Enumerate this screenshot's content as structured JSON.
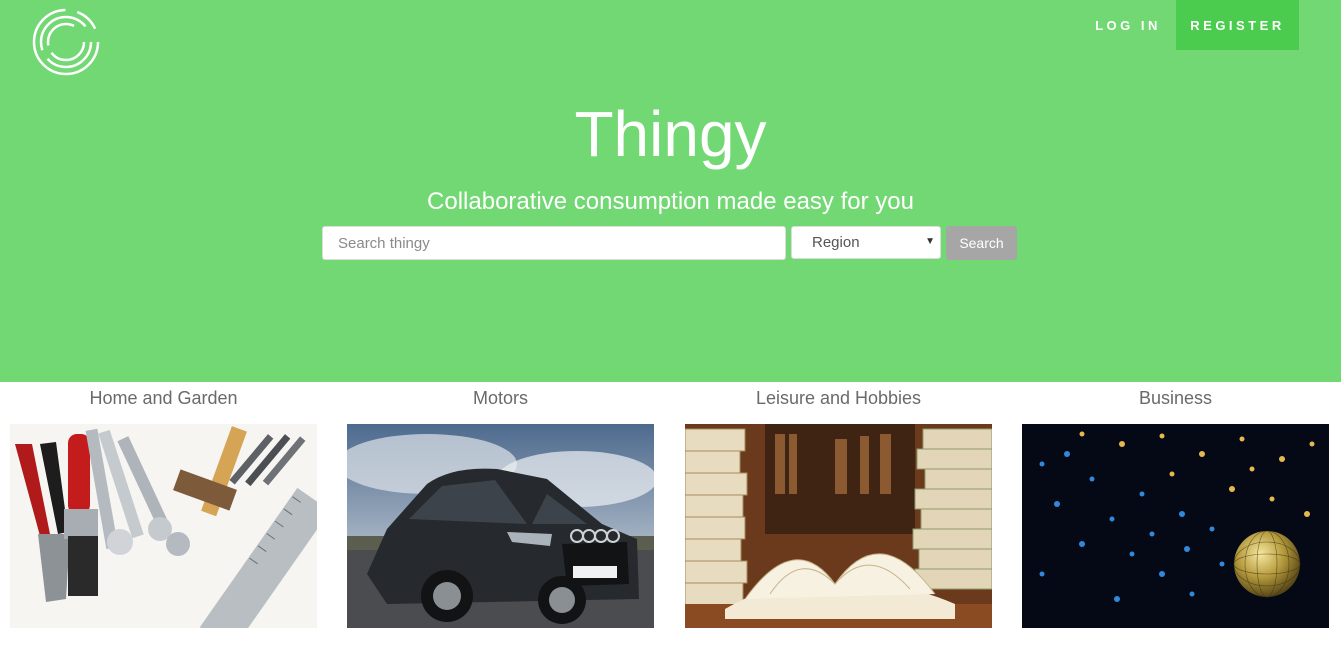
{
  "header": {
    "logo_icon": "ring-logo-icon",
    "login_label": "LOG IN",
    "register_label": "REGISTER"
  },
  "hero": {
    "title": "Thingy",
    "subtitle": "Collaborative consumption made easy for you",
    "search": {
      "placeholder": "Search thingy",
      "value": ""
    },
    "region": {
      "selected": "Region"
    },
    "search_button": "Search"
  },
  "categories": [
    {
      "label": "Home and Garden",
      "image": "tools-photo"
    },
    {
      "label": "Motors",
      "image": "car-photo"
    },
    {
      "label": "Leisure and Hobbies",
      "image": "books-photo"
    },
    {
      "label": "Business",
      "image": "disco-ball-photo"
    }
  ],
  "colors": {
    "hero_background": "#72d874",
    "register_background": "#4ccc4e",
    "search_button_background": "#a6a6a6",
    "category_text": "#6a6a6a"
  }
}
